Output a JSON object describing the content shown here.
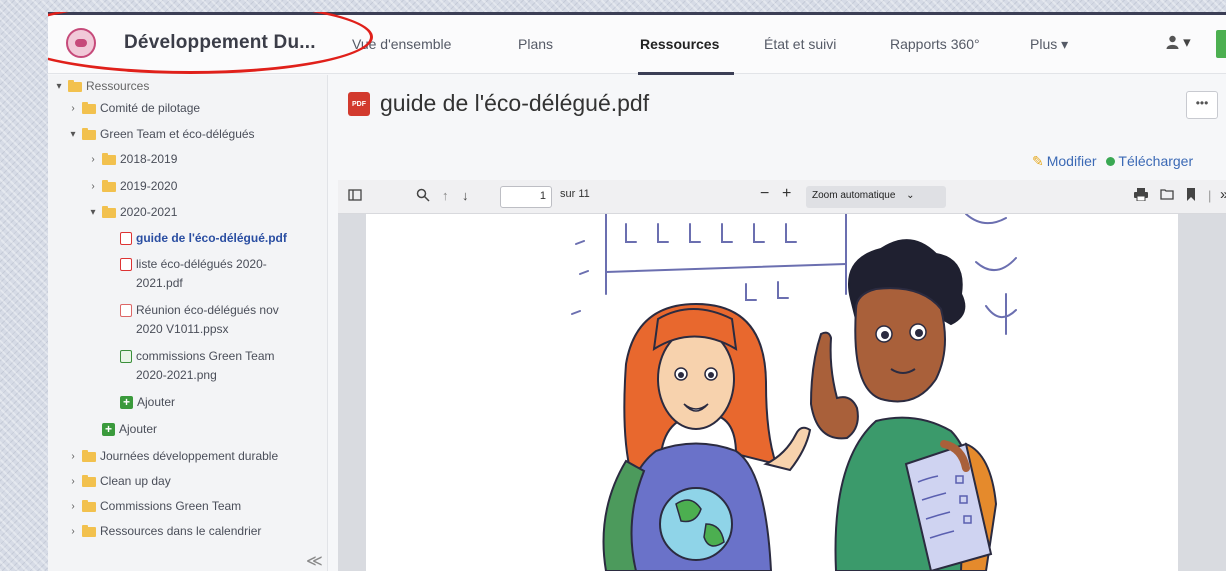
{
  "app": {
    "title": "Développement Du...",
    "nav": [
      "Vue d'ensemble",
      "Plans",
      "Ressources",
      "État et suivi",
      "Rapports 360°",
      "Plus ▾"
    ],
    "active_nav": "Ressources",
    "user_menu": "▾"
  },
  "sidebar": {
    "root": "Ressources",
    "items": [
      {
        "label": "Comité de pilotage"
      },
      {
        "label": "Green Team et éco-délégués"
      },
      {
        "label": "2018-2019"
      },
      {
        "label": "2019-2020"
      },
      {
        "label": "2020-2021"
      },
      {
        "label": "guide de l'éco-délégué.pdf"
      },
      {
        "label": "liste éco-délégués 2020-",
        "label2": "2021.pdf"
      },
      {
        "label": "Réunion éco-délégués nov",
        "label2": "2020 V1011.ppsx"
      },
      {
        "label": "commissions Green Team",
        "label2": "2020-2021.png"
      },
      {
        "label": "Ajouter"
      },
      {
        "label": "Ajouter"
      },
      {
        "label": "Journées développement durable"
      },
      {
        "label": "Clean up day"
      },
      {
        "label": "Commissions Green Team"
      },
      {
        "label": "Ressources dans le calendrier"
      }
    ],
    "collapse": "≪"
  },
  "document": {
    "pdf_badge": "PDF",
    "title": "guide de l'éco-délégué.pdf",
    "more": "•••",
    "edit": "Modifier",
    "download": "Télécharger"
  },
  "pdf_toolbar": {
    "page_value": "1",
    "page_total": "sur 11",
    "zoom": "Zoom automatique"
  },
  "colors": {
    "nav_accent": "#3b3e55",
    "link": "#3b69b5",
    "highlight_oval": "#e0201a",
    "add_green": "#3a9a3c"
  }
}
